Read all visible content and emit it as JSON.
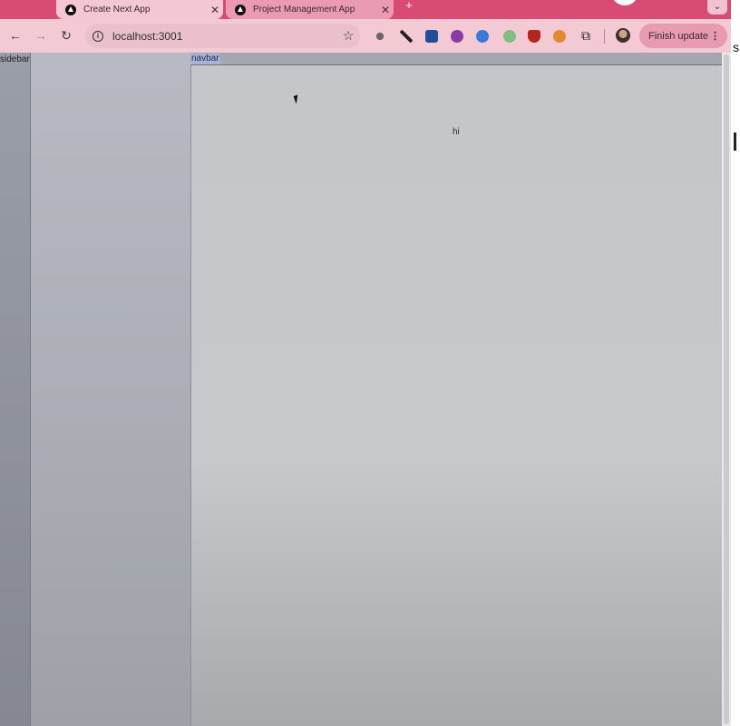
{
  "tabs": [
    {
      "title": "Create Next App",
      "active": true
    },
    {
      "title": "Project Management App",
      "active": false
    }
  ],
  "toolbar": {
    "url": "localhost:3001",
    "update_label": "Finish update"
  },
  "icons": {
    "back": "back-arrow-icon",
    "forward": "forward-arrow-icon",
    "reload": "reload-icon",
    "info": "site-info-icon",
    "star": "bookmark-star-icon",
    "extensions": [
      "bug-extension-icon",
      "color-picker-icon",
      "square-extension-icon",
      "circle-extension-icon",
      "s-extension-icon",
      "frog-extension-icon",
      "ublock-icon",
      "person-extension-icon",
      "puzzle-icon"
    ]
  },
  "page": {
    "sidebar_label": "sidebar",
    "navbar_label": "navbar",
    "main_text": "hi"
  },
  "colors": {
    "tabstrip": "#d94b72",
    "toolbar": "#f3c9d4",
    "navbar_highlight": "#a8b4d2"
  }
}
